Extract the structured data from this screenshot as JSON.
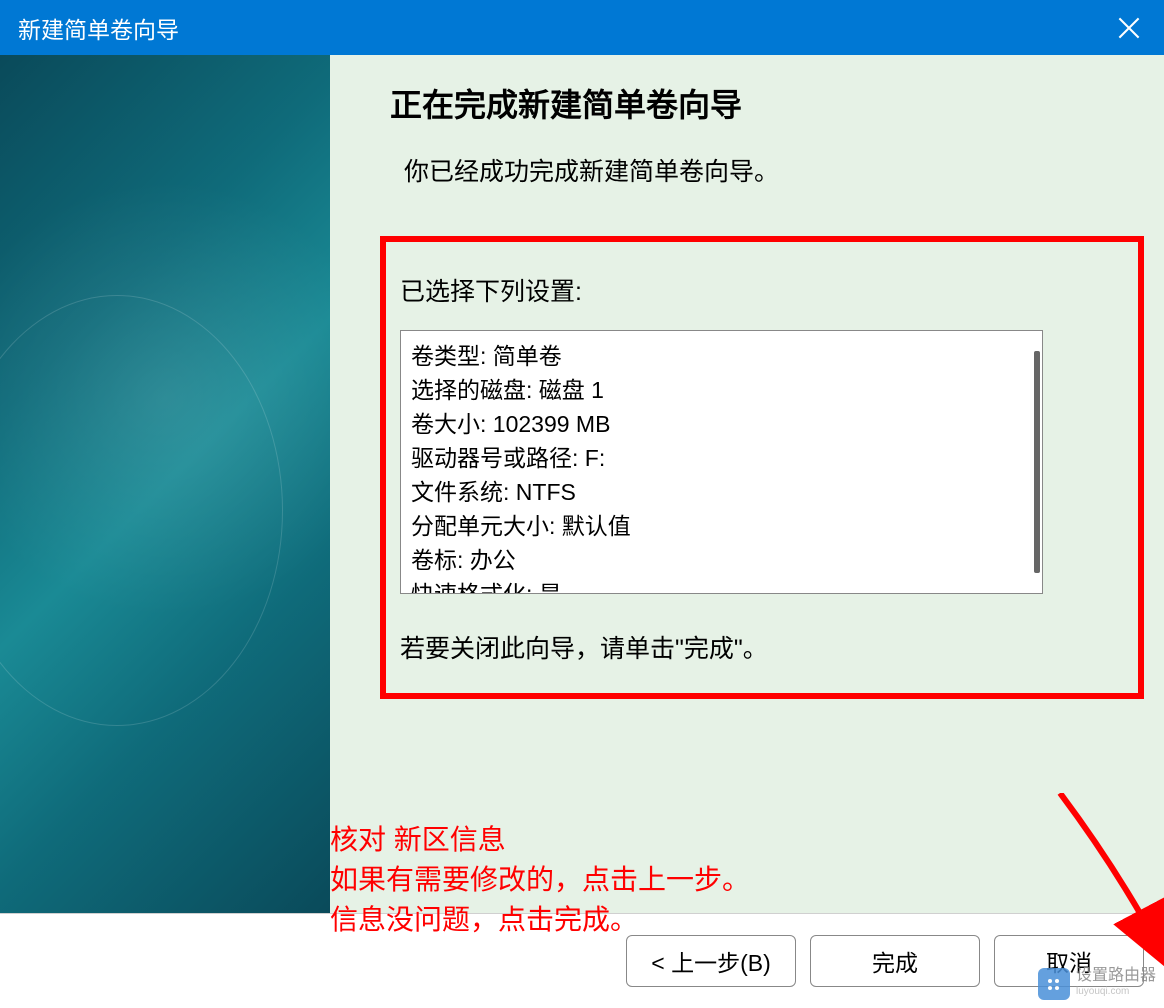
{
  "titlebar": {
    "title": "新建简单卷向导"
  },
  "wizard": {
    "heading": "正在完成新建简单卷向导",
    "success_message": "你已经成功完成新建简单卷向导。",
    "settings_label": "已选择下列设置:",
    "settings": [
      "卷类型: 简单卷",
      "选择的磁盘: 磁盘 1",
      "卷大小: 102399 MB",
      "驱动器号或路径: F:",
      "文件系统: NTFS",
      "分配单元大小: 默认值",
      "卷标: 办公",
      "快速格式化: 是"
    ],
    "close_hint": "若要关闭此向导，请单击\"完成\"。"
  },
  "annotations": {
    "line1": "核对 新区信息",
    "line2": "如果有需要修改的，点击上一步。",
    "line3": "信息没问题，点击完成。"
  },
  "buttons": {
    "back": "< 上一步(B)",
    "finish": "完成",
    "cancel": "取消"
  },
  "watermark": {
    "text_top": "设置路由器",
    "text_bottom": "luyouqi.com"
  }
}
